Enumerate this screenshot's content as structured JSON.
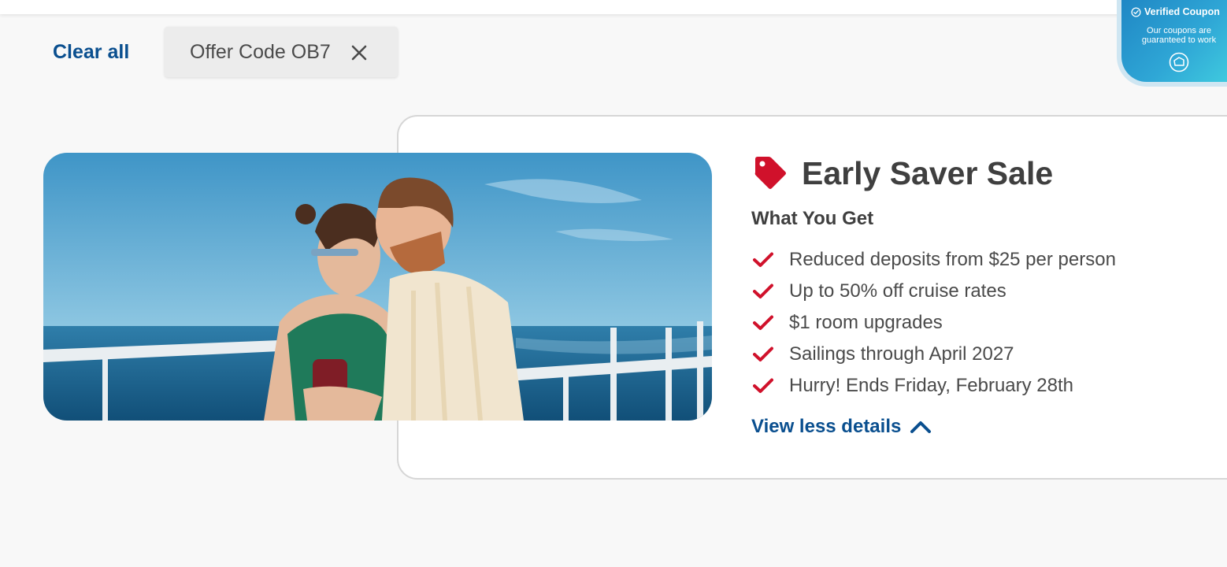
{
  "filters": {
    "clear_all_label": "Clear all",
    "active_chip_label": "Offer Code OB7"
  },
  "verified_badge": {
    "title": "Verified Coupon",
    "subtitle": "Our coupons are guaranteed to work"
  },
  "offer": {
    "title": "Early Saver Sale",
    "section_heading": "What You Get",
    "benefits": [
      "Reduced deposits from $25 per person",
      "Up to 50% off cruise rates",
      "$1 room upgrades",
      "Sailings through April 2027",
      "Hurry! Ends Friday, February 28th"
    ],
    "toggle_details_label": "View less details"
  },
  "icons": {
    "close": "close-icon",
    "tag": "price-tag-icon",
    "check": "checkmark-icon",
    "chevron": "chevron-up-icon",
    "verified": "check-circle-icon",
    "badge_logo": "coupon-logo-icon"
  },
  "colors": {
    "link_blue": "#0a4f8f",
    "accent_red": "#d0112b",
    "text_dark": "#3f3f3f",
    "page_bg": "#f8f8f8"
  }
}
